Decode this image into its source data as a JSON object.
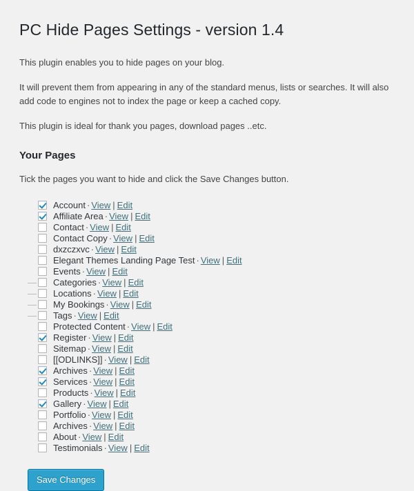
{
  "header": {
    "title": "PC Hide Pages Settings - version 1.4"
  },
  "intro": {
    "paragraphs": [
      "This plugin enables you to hide pages on your blog.",
      "It will prevent them from appearing in any of the standard menus, lists or searches. It will also add code to engines not to index the page or keep a cached copy.",
      "This plugin is ideal for thank you pages, download pages ..etc."
    ]
  },
  "pages_section": {
    "heading": "Your Pages",
    "instruction": "Tick the pages you want to hide and click the Save Changes button.",
    "separator": "·",
    "pipe": "|",
    "view_label": "View",
    "edit_label": "Edit",
    "dash_marker": "—",
    "rows": [
      {
        "label": "Account",
        "checked": true,
        "indent": 0
      },
      {
        "label": "Affiliate Area",
        "checked": true,
        "indent": 0
      },
      {
        "label": "Contact",
        "checked": false,
        "indent": 0
      },
      {
        "label": "Contact Copy",
        "checked": false,
        "indent": 0
      },
      {
        "label": "dxzczxvc",
        "checked": false,
        "indent": 0
      },
      {
        "label": "Elegant Themes Landing Page Test",
        "checked": false,
        "indent": 0
      },
      {
        "label": "Events",
        "checked": false,
        "indent": 0
      },
      {
        "label": "Categories",
        "checked": false,
        "indent": 1
      },
      {
        "label": "Locations",
        "checked": false,
        "indent": 1
      },
      {
        "label": "My Bookings",
        "checked": false,
        "indent": 1
      },
      {
        "label": "Tags",
        "checked": false,
        "indent": 1
      },
      {
        "label": "Protected Content",
        "checked": false,
        "indent": 0
      },
      {
        "label": "Register",
        "checked": true,
        "indent": 0
      },
      {
        "label": "Sitemap",
        "checked": false,
        "indent": 0
      },
      {
        "label": "[[ODLINKS]]",
        "checked": false,
        "indent": 0
      },
      {
        "label": "Archives",
        "checked": true,
        "indent": 0
      },
      {
        "label": "Services",
        "checked": true,
        "indent": 0
      },
      {
        "label": "Products",
        "checked": false,
        "indent": 0
      },
      {
        "label": "Gallery",
        "checked": true,
        "indent": 0
      },
      {
        "label": "Portfolio",
        "checked": false,
        "indent": 0
      },
      {
        "label": "Archives",
        "checked": false,
        "indent": 0
      },
      {
        "label": "About",
        "checked": false,
        "indent": 0
      },
      {
        "label": "Testimonials",
        "checked": false,
        "indent": 0
      }
    ]
  },
  "footer": {
    "save_label": "Save Changes"
  },
  "colors": {
    "background": "#f1f1f1",
    "text": "#444444",
    "heading": "#23282d",
    "link": "#41707d",
    "checkbox_border": "#b4b4b4",
    "checkmark": "#1e8cbe",
    "button_bg": "#2ea2cc",
    "button_border": "#0074a2"
  }
}
